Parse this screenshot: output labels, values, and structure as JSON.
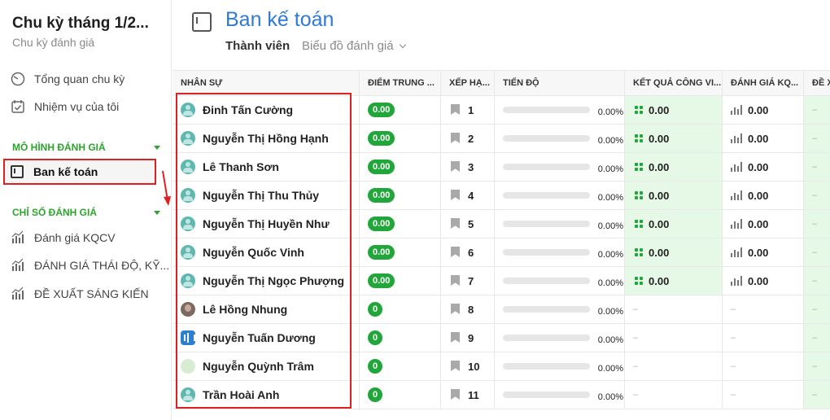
{
  "sidebar": {
    "title": "Chu kỳ tháng 1/2...",
    "subtitle": "Chu kỳ đánh giá",
    "items": [
      {
        "label": "Tổng quan chu kỳ",
        "icon": "gauge-icon"
      },
      {
        "label": "Nhiệm vụ của tôi",
        "icon": "calendar-check-icon"
      }
    ],
    "section1": "MÔ HÌNH ĐÁNH GIÁ",
    "active_item": "Ban kế toán",
    "section2": "CHỈ SỐ ĐÁNH GIÁ",
    "metrics": [
      {
        "label": "Đánh giá KQCV",
        "icon": "chart-icon"
      },
      {
        "label": "ĐÁNH GIÁ THÁI ĐỘ, KỸ...",
        "icon": "chart-icon"
      },
      {
        "label": "ĐỀ XUẤT SÁNG KIẾN",
        "icon": "chart-icon"
      }
    ]
  },
  "header": {
    "title": "Ban kế toán",
    "tab_members": "Thành viên",
    "tab_chart": "Biểu đồ đánh giá"
  },
  "table": {
    "columns": [
      "NHÂN SỰ",
      "ĐIỂM TRUNG ...",
      "XẾP HẠ...",
      "TIẾN ĐỘ",
      "KẾT QUẢ CÔNG VI...",
      "ĐÁNH GIÁ KQ...",
      "ĐỀ X"
    ],
    "rows": [
      {
        "name": "Đinh Tấn Cường",
        "avatar": "teal",
        "score": "0.00",
        "rank": "1",
        "progress": "0.00%",
        "kq": "0.00",
        "dg": "0.00",
        "dx": "–"
      },
      {
        "name": "Nguyễn Thị Hồng Hạnh",
        "avatar": "teal",
        "score": "0.00",
        "rank": "2",
        "progress": "0.00%",
        "kq": "0.00",
        "dg": "0.00",
        "dx": "–"
      },
      {
        "name": "Lê Thanh Sơn",
        "avatar": "teal",
        "score": "0.00",
        "rank": "3",
        "progress": "0.00%",
        "kq": "0.00",
        "dg": "0.00",
        "dx": "–"
      },
      {
        "name": "Nguyễn Thị Thu Thủy",
        "avatar": "teal",
        "score": "0.00",
        "rank": "4",
        "progress": "0.00%",
        "kq": "0.00",
        "dg": "0.00",
        "dx": "–"
      },
      {
        "name": "Nguyễn Thị Huyền Như",
        "avatar": "teal",
        "score": "0.00",
        "rank": "5",
        "progress": "0.00%",
        "kq": "0.00",
        "dg": "0.00",
        "dx": "–"
      },
      {
        "name": "Nguyễn Quốc Vinh",
        "avatar": "teal",
        "score": "0.00",
        "rank": "6",
        "progress": "0.00%",
        "kq": "0.00",
        "dg": "0.00",
        "dx": "–"
      },
      {
        "name": "Nguyễn Thị Ngọc Phượng",
        "avatar": "teal",
        "score": "0.00",
        "rank": "7",
        "progress": "0.00%",
        "kq": "0.00",
        "dg": "0.00",
        "dx": "–"
      },
      {
        "name": "Lê Hồng Nhung",
        "avatar": "photo",
        "score": "0",
        "rank": "8",
        "progress": "0.00%",
        "kq": "–",
        "dg": "–",
        "dx": "–"
      },
      {
        "name": "Nguyễn Tuấn Dương",
        "avatar": "blue",
        "score": "0",
        "rank": "9",
        "progress": "0.00%",
        "kq": "–",
        "dg": "–",
        "dx": "–"
      },
      {
        "name": "Nguyễn Quỳnh Trâm",
        "avatar": "pale",
        "score": "0",
        "rank": "10",
        "progress": "0.00%",
        "kq": "–",
        "dg": "–",
        "dx": "–"
      },
      {
        "name": "Trần Hoài Anh",
        "avatar": "teal",
        "score": "0",
        "rank": "11",
        "progress": "0.00%",
        "kq": "–",
        "dg": "–",
        "dx": "–"
      }
    ]
  },
  "colors": {
    "accent": "#2e7bd6",
    "green": "#21a63a",
    "highlight": "#e02020"
  }
}
